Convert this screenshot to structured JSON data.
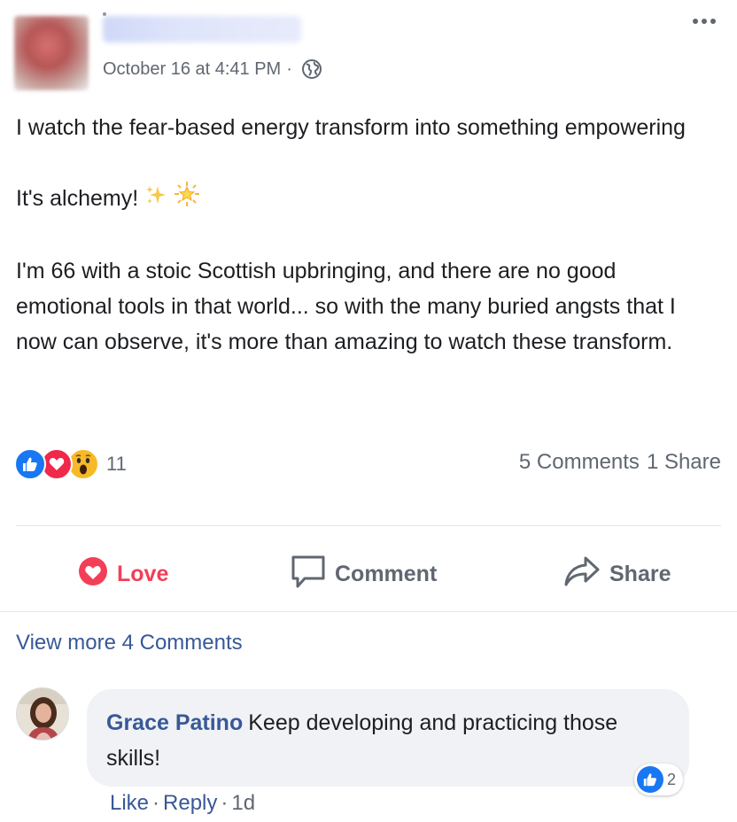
{
  "post": {
    "timestamp": "October 16 at 4:41 PM",
    "separator": "·",
    "privacy_icon": "globe-icon",
    "more_icon": "more-options-icon",
    "paragraphs": [
      "I watch the fear-based energy transform into something empowering",
      "It's alchemy!",
      "I'm 66 with a stoic Scottish upbringing, and there are no good emotional tools in that world... so with the many buried angsts that I now can observe, it's more than amazing to watch these transform."
    ],
    "emojis": [
      "sparkles-emoji",
      "glowing-star-emoji"
    ]
  },
  "reactions": {
    "types": [
      "like",
      "love",
      "wow"
    ],
    "count": "11",
    "comments": "5 Comments",
    "shares": "1 Share"
  },
  "actions": {
    "love": "Love",
    "comment": "Comment",
    "share": "Share"
  },
  "view_more": "View more 4 Comments",
  "comment": {
    "author": "Grace Patino",
    "text": "Keep developing and practicing those skills!",
    "like_count": "2",
    "like_label": "Like",
    "reply_label": "Reply",
    "separator": "·",
    "age": "1d"
  },
  "colors": {
    "link": "#385898",
    "like_blue": "#1877f2",
    "love_red": "#f33e58",
    "wow_yellow": "#f7b928",
    "muted": "#606770"
  }
}
